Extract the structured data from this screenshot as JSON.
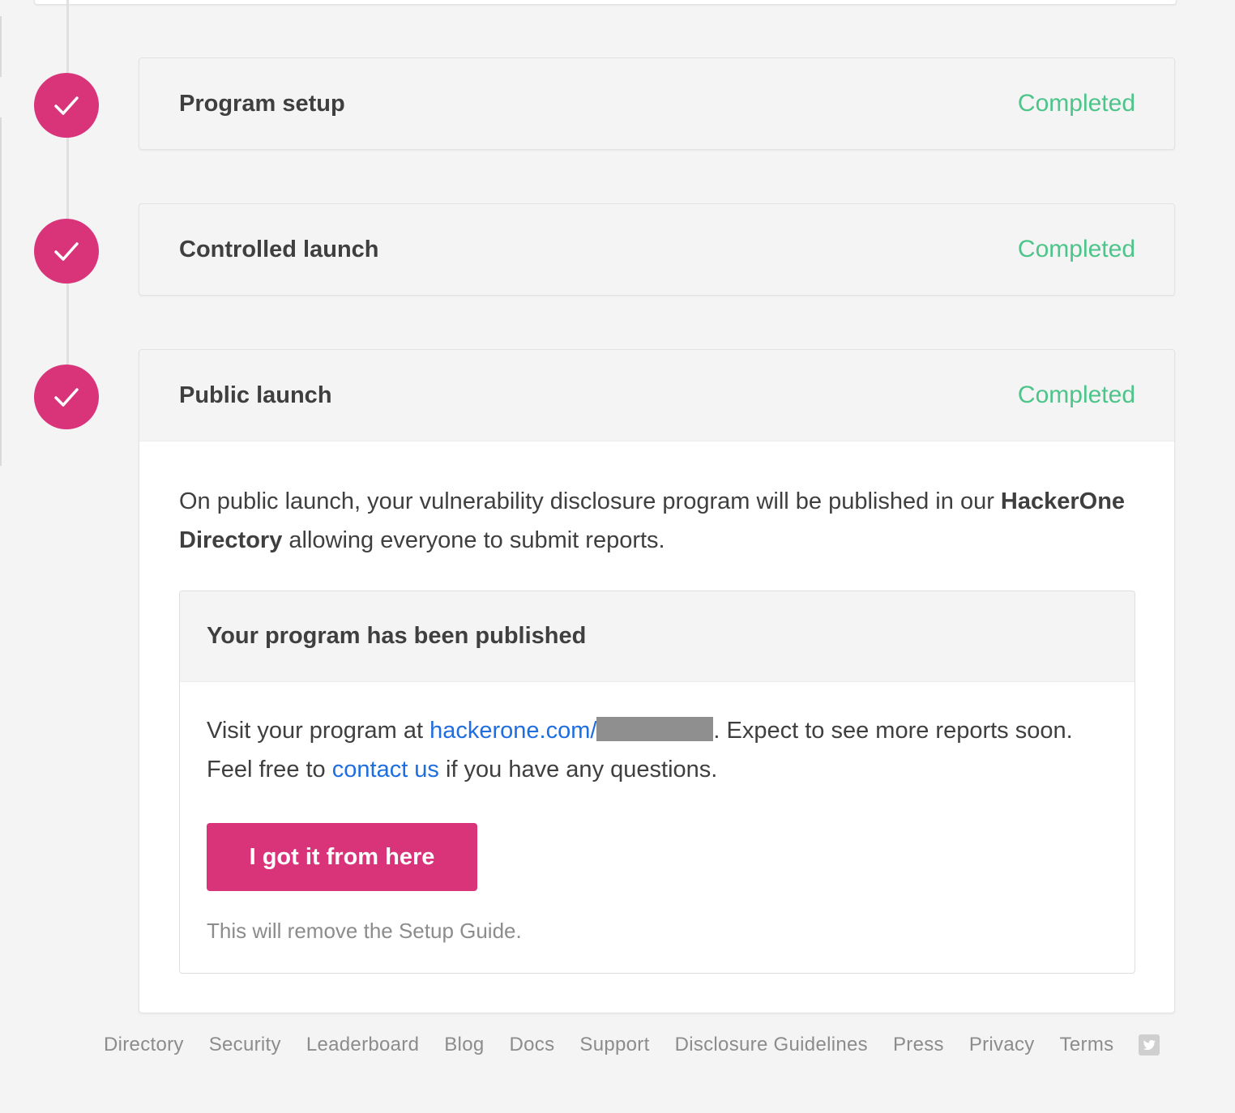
{
  "steps": [
    {
      "title": "Program setup",
      "status": "Completed"
    },
    {
      "title": "Controlled launch",
      "status": "Completed"
    },
    {
      "title": "Public launch",
      "status": "Completed"
    }
  ],
  "public_launch": {
    "desc_before": "On public launch, your vulnerability disclosure program will be published in our ",
    "desc_bold": "HackerOne Directory",
    "desc_after": " allowing everyone to submit reports.",
    "published": {
      "title": "Your program has been published",
      "text_before_link": "Visit your program at ",
      "program_link": "hackerone.com/",
      "text_after_link": ". Expect to see more reports soon. Feel free to ",
      "contact_link": "contact us",
      "text_end": " if you have any questions.",
      "button_label": "I got it from here",
      "hint": "This will remove the Setup Guide."
    }
  },
  "footer": {
    "links": [
      "Directory",
      "Security",
      "Leaderboard",
      "Blog",
      "Docs",
      "Support",
      "Disclosure Guidelines",
      "Press",
      "Privacy",
      "Terms"
    ],
    "social_icon": "twitter-icon"
  },
  "colors": {
    "accent": "#d9347a",
    "completed": "#4cc48a",
    "link": "#1f6ee0"
  }
}
